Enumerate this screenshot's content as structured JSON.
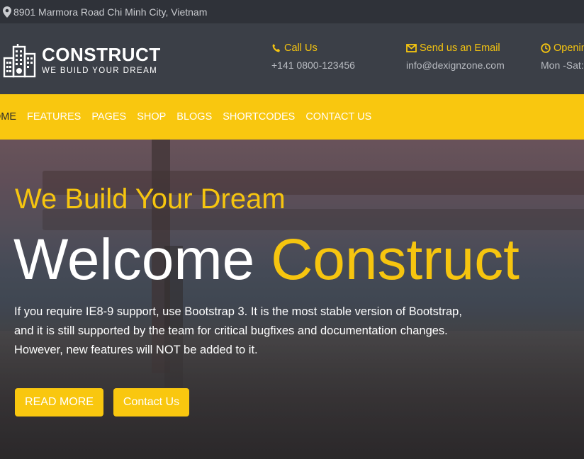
{
  "topbar": {
    "address": "8901 Marmora Road Chi Minh City, Vietnam"
  },
  "logo": {
    "brand": "CONSTRUCT",
    "tagline": "WE BUILD YOUR DREAM"
  },
  "contacts": [
    {
      "label": "Call Us",
      "value": "+141 0800-123456",
      "icon": "phone-icon"
    },
    {
      "label": "Send us an Email",
      "value": "info@dexignzone.com",
      "icon": "envelope-icon"
    },
    {
      "label": "Openin",
      "value": "Mon -Sat:",
      "icon": "clock-icon"
    }
  ],
  "nav": {
    "items": [
      "OME",
      "FEATURES",
      "PAGES",
      "SHOP",
      "BLOGS",
      "SHORTCODES",
      "CONTACT US"
    ]
  },
  "hero": {
    "subtitle": "We Build Your Dream",
    "title_main": "Welcome",
    "title_accent": "Construct",
    "description": "If you require IE8-9 support, use Bootstrap 3. It is the most stable version of Bootstrap, and it is still supported by the team for critical bugfixes and documentation changes. However, new features will NOT be added to it.",
    "read_more": "READ MORE",
    "contact_us": "Contact Us"
  },
  "colors": {
    "accent": "#f9c70f",
    "header_bg": "#3b3f47",
    "topbar_bg": "#2f3239"
  }
}
